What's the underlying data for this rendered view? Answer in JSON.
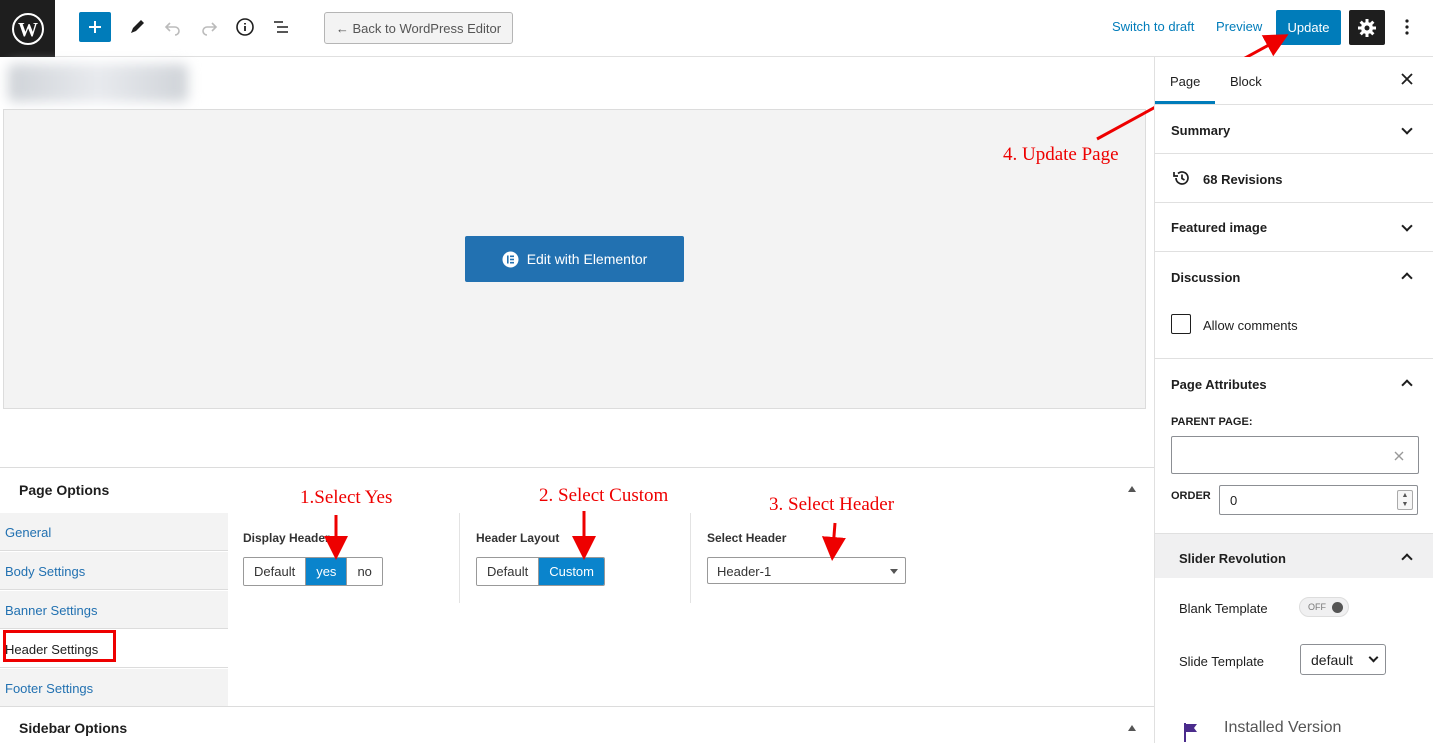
{
  "toolbar": {
    "back_label": "← Back to WordPress Editor",
    "switch_draft": "Switch to draft",
    "preview": "Preview",
    "update": "Update"
  },
  "editor": {
    "elementor_button": "Edit with Elementor"
  },
  "page_options": {
    "title": "Page Options",
    "tabs": [
      {
        "label": "General"
      },
      {
        "label": "Body Settings"
      },
      {
        "label": "Banner Settings"
      },
      {
        "label": "Header Settings"
      },
      {
        "label": "Footer Settings"
      }
    ],
    "display_header": {
      "label": "Display Header",
      "options": [
        "Default",
        "yes",
        "no"
      ],
      "selected": "yes"
    },
    "header_layout": {
      "label": "Header Layout",
      "options": [
        "Default",
        "Custom"
      ],
      "selected": "Custom"
    },
    "select_header": {
      "label": "Select Header",
      "value": "Header-1"
    },
    "sidebar_options": "Sidebar Options"
  },
  "annotations": {
    "step1": "1.Select Yes",
    "step2": "2. Select Custom",
    "step3": "3. Select Header",
    "step4": "4. Update Page"
  },
  "sidebar": {
    "tab_page": "Page",
    "tab_block": "Block",
    "summary": "Summary",
    "revisions": "68 Revisions",
    "featured_image": "Featured image",
    "discussion": "Discussion",
    "allow_comments": "Allow comments",
    "page_attributes": "Page Attributes",
    "parent_page_label": "PARENT PAGE:",
    "order_label": "ORDER",
    "order_value": "0",
    "slider_revolution": "Slider Revolution",
    "blank_template": "Blank Template",
    "toggle_state": "OFF",
    "slide_template": "Slide Template",
    "slide_template_value": "default",
    "installed_version": "Installed Version"
  },
  "colors": {
    "accent": "#007cba",
    "annotation": "#ee0000",
    "dark": "#1e1e1e"
  }
}
